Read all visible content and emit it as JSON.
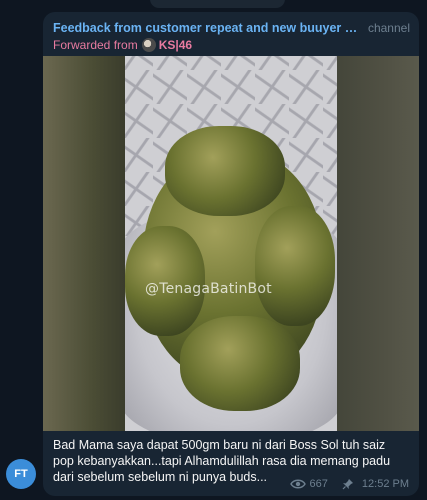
{
  "top_pill": {
    "text": ""
  },
  "post": {
    "channel_title": "Feedback from customer repeat and new buuyer #thai...",
    "channel_tag": "channel",
    "forwarded_prefix": "Forwarded from",
    "forwarded_source": "KS|46",
    "watermark": "@TenagaBatinBot",
    "caption": "Bad Mama saya dapat 500gm baru ni dari Boss Sol tuh saiz pop kebanyakkan...tapi Alhamdulillah rasa dia memang padu dari sebelum sebelum ni punya buds...",
    "views": "667",
    "time": "12:52 PM"
  },
  "author_avatar": {
    "initials": "FT",
    "color": "#3b8dd9"
  },
  "icons": {
    "views": "eye-icon",
    "pinned": "pin-icon",
    "forward_avatar": "source-avatar"
  },
  "colors": {
    "background": "#0e1621",
    "bubble": "#182533",
    "title": "#6ab3f3",
    "forwarded": "#e87ba0",
    "meta": "#6d7f8f"
  }
}
